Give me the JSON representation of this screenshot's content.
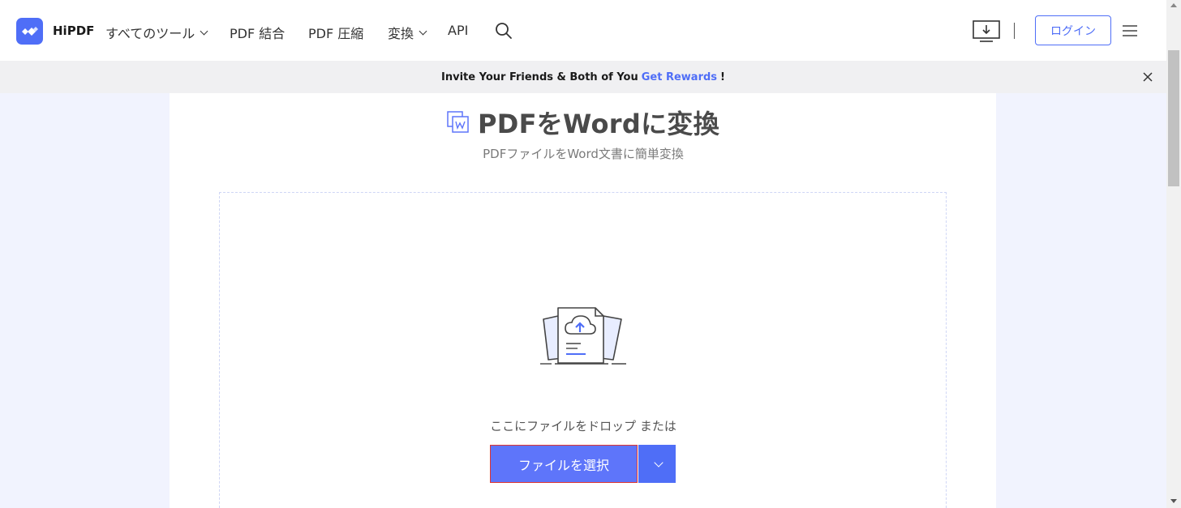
{
  "header": {
    "brand": "HiPDF",
    "nav": [
      {
        "label": "すべてのツール",
        "has_dropdown": true
      },
      {
        "label": "PDF 結合",
        "has_dropdown": false
      },
      {
        "label": "PDF 圧縮",
        "has_dropdown": false
      },
      {
        "label": "変換",
        "has_dropdown": true
      },
      {
        "label": "API",
        "has_dropdown": false
      }
    ],
    "login_label": "ログイン",
    "icons": [
      "hipdf-logo-icon",
      "search-icon",
      "download-desktop-icon",
      "hamburger-menu-icon"
    ]
  },
  "banner": {
    "text": "Invite Your Friends & Both of You",
    "link": "Get Rewards",
    "suffix": "!"
  },
  "main": {
    "title": "PDFをWordに変換",
    "subtitle": "PDFファイルをWord文書に簡単変換",
    "drop_text": "ここにファイルをドロップ または",
    "select_button": "ファイルを選択"
  },
  "colors": {
    "accent": "#4f6ef7",
    "button": "#5e75fa",
    "page_bg": "#f1f3fe"
  }
}
